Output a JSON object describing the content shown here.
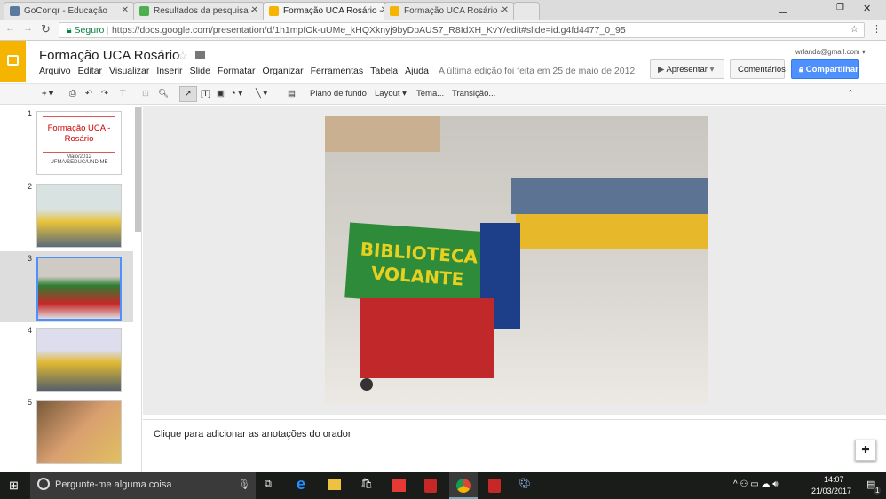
{
  "browser": {
    "tabs": [
      {
        "label": "GoConqr - Educação",
        "active": false,
        "color": "#5a7aa0"
      },
      {
        "label": "Resultados da pesquisa -",
        "active": false,
        "color": "#4caf50"
      },
      {
        "label": "Formação UCA Rosário -",
        "active": true,
        "color": "#f4b400"
      },
      {
        "label": "Formação UCA Rosário -",
        "active": false,
        "color": "#f4b400"
      }
    ],
    "secure_label": "Seguro",
    "url": "https://docs.google.com/presentation/d/1h1mpfOk-uUMe_kHQXknyj9byDpAUS7_R8IdXH_KvY/edit#slide=id.g4fd4477_0_95"
  },
  "app": {
    "title": "Formação UCA Rosário",
    "account": "wrlanda@gmail.com",
    "menu": [
      "Arquivo",
      "Editar",
      "Visualizar",
      "Inserir",
      "Slide",
      "Formatar",
      "Organizar",
      "Ferramentas",
      "Tabela",
      "Ajuda"
    ],
    "last_edit": "A última edição foi feita em 25 de maio de 2012",
    "present_label": "Apresentar",
    "comments_label": "Comentários",
    "share_label": "Compartilhar",
    "accent": "#4d90fe"
  },
  "toolbar": {
    "background": "Plano de fundo",
    "layout": "Layout",
    "theme": "Tema...",
    "transition": "Transição..."
  },
  "slides": [
    {
      "num": "1",
      "title": "Formação UCA - Rosário",
      "subtitle1": "Maio/2012",
      "subtitle2": "UFMA/SEDUC/UNDIME"
    },
    {
      "num": "2"
    },
    {
      "num": "3"
    },
    {
      "num": "4"
    },
    {
      "num": "5"
    }
  ],
  "current_slide": {
    "banner_line1": "BIBLIOTECA",
    "banner_line2": "VOLANTE"
  },
  "notes_placeholder": "Clique para adicionar as anotações do orador",
  "taskbar": {
    "search": "Pergunte-me alguma coisa",
    "time": "14:07",
    "date": "21/03/2017",
    "notifications": "1"
  }
}
